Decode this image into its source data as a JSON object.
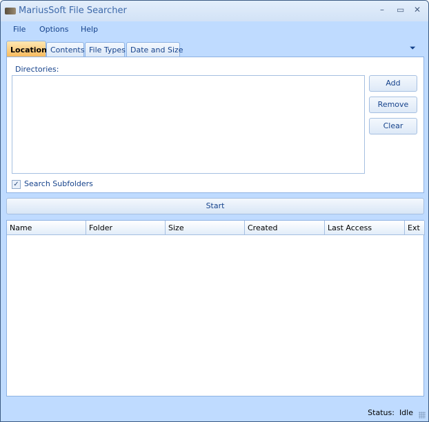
{
  "window": {
    "title": "MariusSoft File Searcher",
    "minimize": "–",
    "maximize": "▭",
    "close": "✕"
  },
  "menu": [
    "File",
    "Options",
    "Help"
  ],
  "tabs": [
    "Location",
    "Contents",
    "File Types",
    "Date and Size"
  ],
  "tab_overflow": "⏷",
  "location": {
    "directories_label": "Directories:",
    "buttons": [
      "Add",
      "Remove",
      "Clear"
    ],
    "checkbox_label": "Search Subfolders",
    "checkbox_mark": "✓"
  },
  "start_label": "Start",
  "columns": [
    "Name",
    "Folder",
    "Size",
    "Created",
    "Last Access",
    "Ext"
  ],
  "status": {
    "label": "Status:",
    "value": "Idle"
  }
}
